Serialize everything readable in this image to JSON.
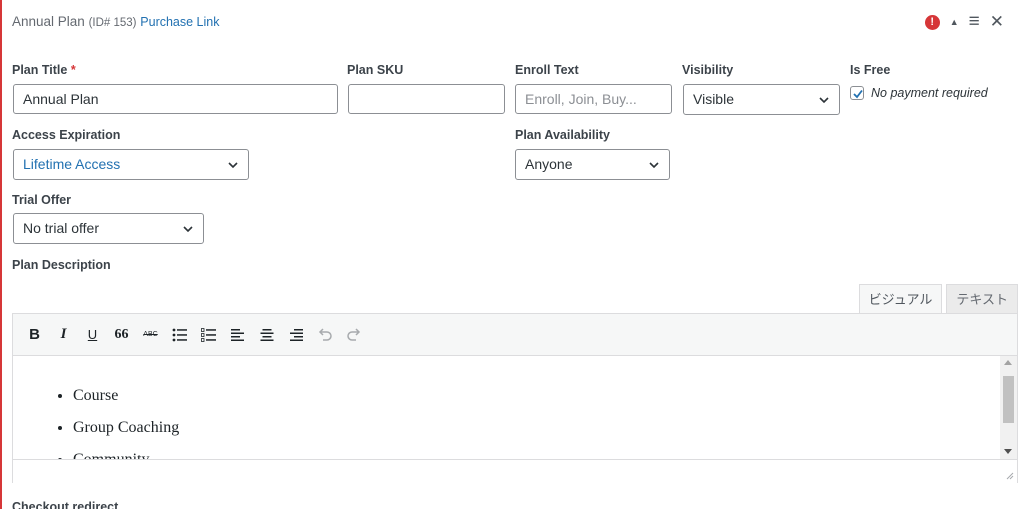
{
  "header": {
    "title": "Annual Plan",
    "id_text": "(ID# 153)",
    "purchase_link": "Purchase Link",
    "icons": [
      "error-icon",
      "collapse-up-icon",
      "menu-icon",
      "close-icon"
    ],
    "error_glyph": "!",
    "up_glyph": "▲",
    "menu_glyph": "≡",
    "close_glyph": "✕"
  },
  "fields": {
    "plan_title": {
      "label": "Plan Title",
      "required_mark": "*",
      "value": "Annual Plan"
    },
    "plan_sku": {
      "label": "Plan SKU",
      "value": ""
    },
    "enroll_text": {
      "label": "Enroll Text",
      "placeholder": "Enroll, Join, Buy..."
    },
    "visibility": {
      "label": "Visibility",
      "value": "Visible"
    },
    "is_free": {
      "label": "Is Free",
      "checkbox_label": "No payment required",
      "checked": true
    },
    "access_expiration": {
      "label": "Access Expiration",
      "value": "Lifetime Access"
    },
    "plan_availability": {
      "label": "Plan Availability",
      "value": "Anyone"
    },
    "trial_offer": {
      "label": "Trial Offer",
      "value": "No trial offer"
    },
    "plan_description": {
      "label": "Plan Description"
    }
  },
  "editor": {
    "tabs": [
      {
        "label": "ビジュアル",
        "active": true
      },
      {
        "label": "テキスト",
        "active": false
      }
    ],
    "toolbar": {
      "bold": "B",
      "italic": "I",
      "underline": "U",
      "blockquote": "66",
      "strike": "ABC"
    },
    "content_items": [
      "Course",
      "Group Coaching",
      "Community"
    ]
  },
  "next_section_label": "Checkout redirect",
  "colors": {
    "accent_blue": "#2271b1",
    "error_red": "#d63638",
    "border": "#8c8f94"
  }
}
